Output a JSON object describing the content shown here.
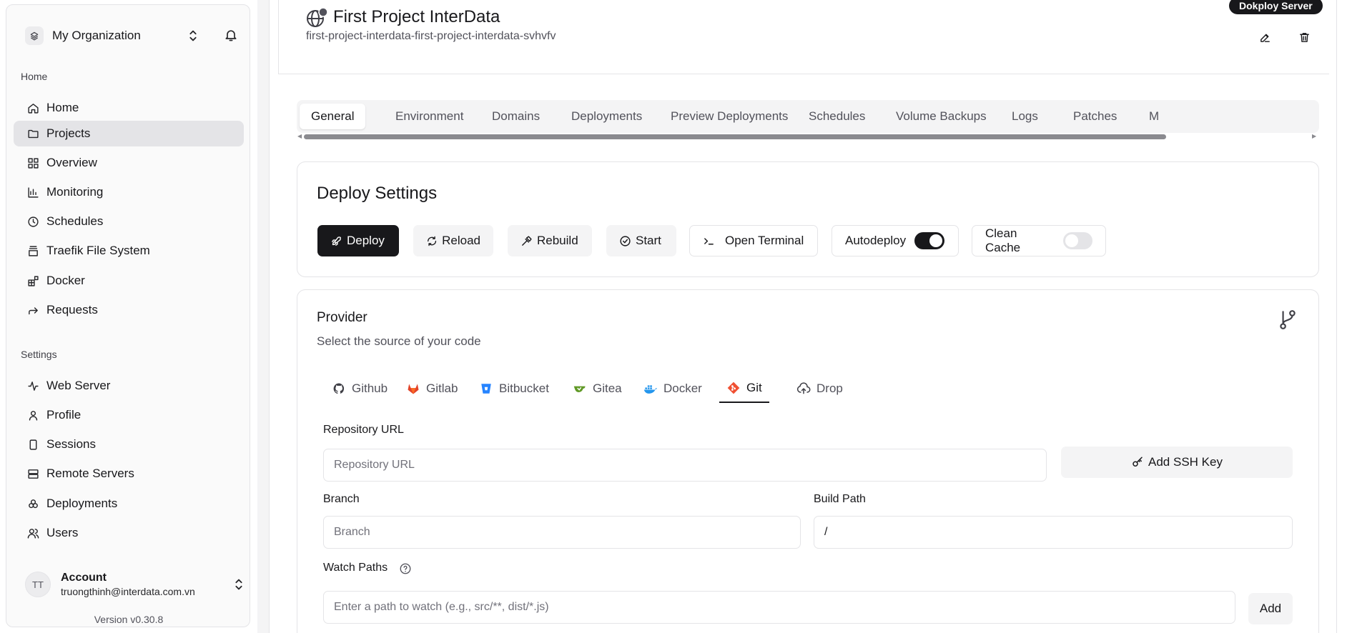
{
  "sidebar": {
    "org_name": "My Organization",
    "home_section": "Home",
    "home_items": [
      {
        "label": "Home",
        "icon": "home-icon"
      },
      {
        "label": "Projects",
        "icon": "folder-icon"
      },
      {
        "label": "Overview",
        "icon": "grid-icon"
      },
      {
        "label": "Monitoring",
        "icon": "chart-icon"
      },
      {
        "label": "Schedules",
        "icon": "clock-icon"
      },
      {
        "label": "Traefik File System",
        "icon": "file-stack-icon"
      },
      {
        "label": "Docker",
        "icon": "blocks-icon"
      },
      {
        "label": "Requests",
        "icon": "arrow-forward-icon"
      }
    ],
    "settings_section": "Settings",
    "settings_items": [
      {
        "label": "Web Server",
        "icon": "activity-icon"
      },
      {
        "label": "Profile",
        "icon": "user-icon"
      },
      {
        "label": "Sessions",
        "icon": "phone-icon"
      },
      {
        "label": "Remote Servers",
        "icon": "server-icon"
      },
      {
        "label": "Deployments",
        "icon": "boxes-icon"
      },
      {
        "label": "Users",
        "icon": "users-icon"
      }
    ],
    "account": {
      "initials": "TT",
      "name": "Account",
      "email": "truongthinh@interdata.com.vn"
    },
    "version": "Version v0.30.8"
  },
  "header": {
    "title": "First Project InterData",
    "slug": "first-project-interdata-first-project-interdata-svhvfv",
    "server_badge": "Dokploy Server"
  },
  "tabs": [
    "General",
    "Environment",
    "Domains",
    "Deployments",
    "Preview Deployments",
    "Schedules",
    "Volume Backups",
    "Logs",
    "Patches",
    "M"
  ],
  "deploy": {
    "title": "Deploy Settings",
    "deploy_label": "Deploy",
    "reload_label": "Reload",
    "rebuild_label": "Rebuild",
    "start_label": "Start",
    "terminal_label": "Open Terminal",
    "autodeploy_label": "Autodeploy",
    "autodeploy_on": true,
    "clean_cache_label": "Clean Cache",
    "clean_cache_on": false
  },
  "provider": {
    "title": "Provider",
    "subtitle": "Select the source of your code",
    "tabs": [
      {
        "label": "Github",
        "icon": "github-icon",
        "color": "#52525b"
      },
      {
        "label": "Gitlab",
        "icon": "gitlab-icon",
        "color": "#e24329"
      },
      {
        "label": "Bitbucket",
        "icon": "bitbucket-icon",
        "color": "#2684ff"
      },
      {
        "label": "Gitea",
        "icon": "gitea-icon",
        "color": "#609926"
      },
      {
        "label": "Docker",
        "icon": "docker-icon",
        "color": "#2496ed"
      },
      {
        "label": "Git",
        "icon": "git-icon",
        "color": "#f05032"
      },
      {
        "label": "Drop",
        "icon": "upload-cloud-icon",
        "color": "#52525b"
      }
    ],
    "active_tab": "Git",
    "repo_label": "Repository URL",
    "repo_placeholder": "Repository URL",
    "ssh_label": "Add SSH Key",
    "branch_label": "Branch",
    "branch_placeholder": "Branch",
    "build_path_label": "Build Path",
    "build_path_value": "/",
    "watch_label": "Watch Paths",
    "watch_placeholder": "Enter a path to watch (e.g., src/**, dist/*.js)",
    "add_label": "Add"
  }
}
